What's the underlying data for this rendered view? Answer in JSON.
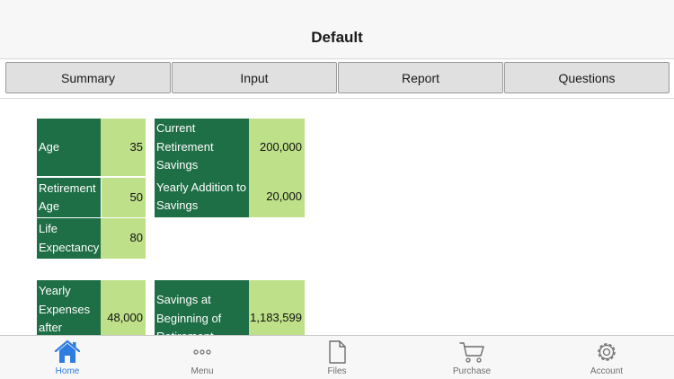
{
  "navbar": {
    "title": "Default"
  },
  "tabs": [
    {
      "label": "Summary"
    },
    {
      "label": "Input"
    },
    {
      "label": "Report"
    },
    {
      "label": "Questions"
    }
  ],
  "left_group": [
    {
      "label": "Age",
      "value": "35"
    },
    {
      "label": "Retirement Age",
      "value": "50"
    },
    {
      "label": "Life Expectancy",
      "value": "80"
    }
  ],
  "right_group": [
    {
      "label": "Current Retirement Savings",
      "value": "200,000"
    },
    {
      "label": "Yearly Addition to Savings",
      "value": "20,000"
    }
  ],
  "lower_left": {
    "label": "Yearly Expenses after",
    "value": "48,000"
  },
  "lower_right": {
    "label": "Savings at Beginning of Retirement",
    "value": "1,183,599"
  },
  "tabbar": [
    {
      "label": "Home",
      "icon": "home-icon",
      "active": true
    },
    {
      "label": "Menu",
      "icon": "more-icon",
      "active": false
    },
    {
      "label": "Files",
      "icon": "file-icon",
      "active": false
    },
    {
      "label": "Purchase",
      "icon": "cart-icon",
      "active": false
    },
    {
      "label": "Account",
      "icon": "gear-icon",
      "active": false
    }
  ],
  "colors": {
    "label_bg": "#1e6e46",
    "value_bg": "#bde089",
    "accent": "#2f7de1"
  }
}
